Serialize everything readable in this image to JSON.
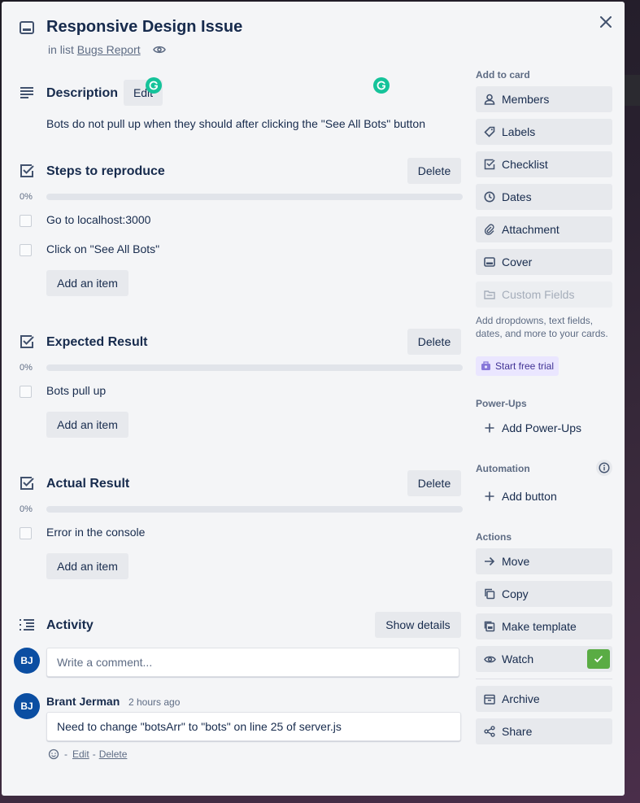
{
  "card": {
    "title": "Responsive Design Issue",
    "in_list_prefix": "in list",
    "list_name": "Bugs Report"
  },
  "description": {
    "heading": "Description",
    "edit_label": "Edit",
    "text": "Bots do not pull up when they should after clicking the \"See All Bots\" button"
  },
  "checklists": [
    {
      "title": "Steps to reproduce",
      "delete_label": "Delete",
      "percent": "0%",
      "progress": 0,
      "items": [
        "Go to localhost:3000",
        "Click on \"See All Bots\""
      ],
      "add_label": "Add an item"
    },
    {
      "title": "Expected Result",
      "delete_label": "Delete",
      "percent": "0%",
      "progress": 0,
      "items": [
        "Bots pull up"
      ],
      "add_label": "Add an item"
    },
    {
      "title": "Actual Result",
      "delete_label": "Delete",
      "percent": "0%",
      "progress": 0,
      "items": [
        "Error in the console"
      ],
      "add_label": "Add an item"
    }
  ],
  "activity": {
    "heading": "Activity",
    "show_details_label": "Show details",
    "comment_placeholder": "Write a comment...",
    "avatar_initials": "BJ",
    "comments": [
      {
        "author": "Brant Jerman",
        "time": "2 hours ago",
        "text": "Need to change \"botsArr\" to \"bots\" on line 25 of server.js",
        "avatar_initials": "BJ",
        "edit_label": "Edit",
        "delete_label": "Delete",
        "separator": "-"
      }
    ]
  },
  "sidebar": {
    "add_to_card_label": "Add to card",
    "add_to_card": [
      "Members",
      "Labels",
      "Checklist",
      "Dates",
      "Attachment",
      "Cover",
      "Custom Fields"
    ],
    "custom_fields_hint": "Add dropdowns, text fields, dates, and more to your cards.",
    "start_trial_label": "Start free trial",
    "powerups_label": "Power-Ups",
    "add_powerups_label": "Add Power-Ups",
    "automation_label": "Automation",
    "add_button_label": "Add button",
    "actions_label": "Actions",
    "actions": [
      "Move",
      "Copy",
      "Make template",
      "Watch",
      "Archive",
      "Share"
    ],
    "watch_checked": true
  },
  "colors": {
    "accent_green": "#5aac44",
    "avatar_blue": "#0b4ea2",
    "grammarly_green": "#15c39a",
    "trial_purple": "#eae6ff"
  }
}
